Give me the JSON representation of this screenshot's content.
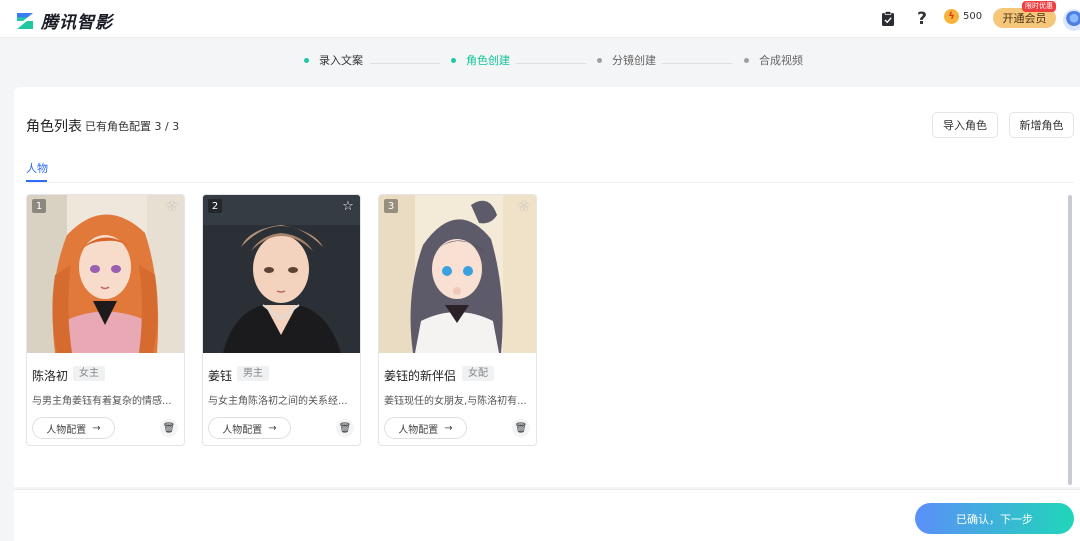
{
  "header": {
    "logo_text": "腾讯智影",
    "credits": "500",
    "vip_button": "开通会员",
    "vip_badge": "限时优惠",
    "icons": [
      "clipboard-icon",
      "help-icon",
      "coin-icon",
      "user-avatar"
    ]
  },
  "steps": [
    {
      "label": "录入文案",
      "state": "done"
    },
    {
      "label": "角色创建",
      "state": "active"
    },
    {
      "label": "分镜创建",
      "state": "pending"
    },
    {
      "label": "合成视频",
      "state": "pending"
    }
  ],
  "panel": {
    "title": "角色列表",
    "count": "已有角色配置 3 / 3",
    "import_button": "导入角色",
    "add_button": "新增角色",
    "tab": "人物"
  },
  "characters": [
    {
      "number": "1",
      "name": "陈洛初",
      "tag": "女主",
      "desc": "与男主角姜钰有着复杂的情感...",
      "config_label": "人物配置"
    },
    {
      "number": "2",
      "name": "姜钰",
      "tag": "男主",
      "desc": "与女主角陈洛初之间的关系经...",
      "config_label": "人物配置"
    },
    {
      "number": "3",
      "name": "姜钰的新伴侣",
      "tag": "女配",
      "desc": "姜钰现任的女朋友,与陈洛初有...",
      "config_label": "人物配置"
    }
  ],
  "footer": {
    "next_button": "已确认，下一步"
  },
  "colors": {
    "accent_green": "#15c39a",
    "accent_blue": "#2d6cf6",
    "vip_gold": "#f6c77b"
  }
}
